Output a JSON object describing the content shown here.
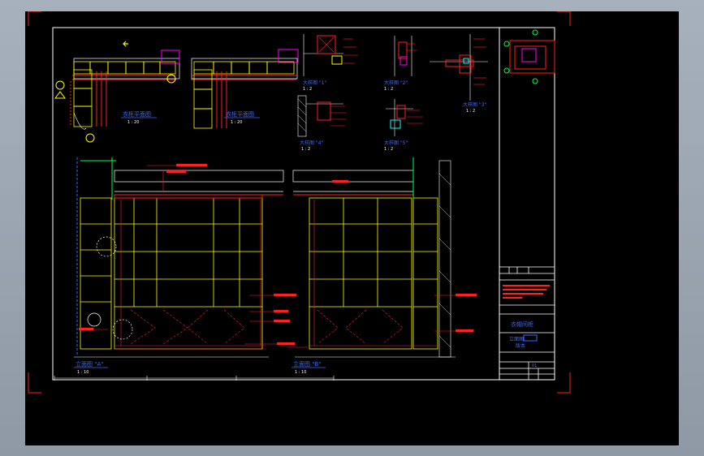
{
  "drawing": {
    "background": "#000000",
    "border_color": "#ffffff",
    "colors": {
      "red": "#ff2020",
      "yellow": "#ffff00",
      "green": "#00ff40",
      "blue": "#3a6bff",
      "cyan": "#00ffff",
      "magenta": "#ff00ff",
      "white": "#ffffff",
      "orange": "#ff8000"
    },
    "views": {
      "plan_a": {
        "title": "衣柜平面图",
        "scale": "1 : 20"
      },
      "plan_b": {
        "title": "衣柜平面图",
        "scale": "1 : 20"
      },
      "detail_1": {
        "title": "大样图 \"1\"",
        "scale": "1 : 2"
      },
      "detail_2": {
        "title": "大样图 \"2\"",
        "scale": "1 : 2"
      },
      "detail_3": {
        "title": "大样图 \"3\"",
        "scale": "1 : 2"
      },
      "detail_4": {
        "title": "大样图 \"4\"",
        "scale": "1 : 2"
      },
      "detail_5": {
        "title": "大样图 \"5\"",
        "scale": "1 : 2"
      },
      "elevation_a": {
        "title": "立面图 \"A\"",
        "scale": "1 : 10"
      },
      "elevation_b": {
        "title": "立面图 \"B\"",
        "scale": "1 : 10"
      }
    },
    "title_block": {
      "project_name": "衣帽间柜",
      "drawing_type": "立面图",
      "sheet_no": "01",
      "rev_label": "版本"
    }
  }
}
